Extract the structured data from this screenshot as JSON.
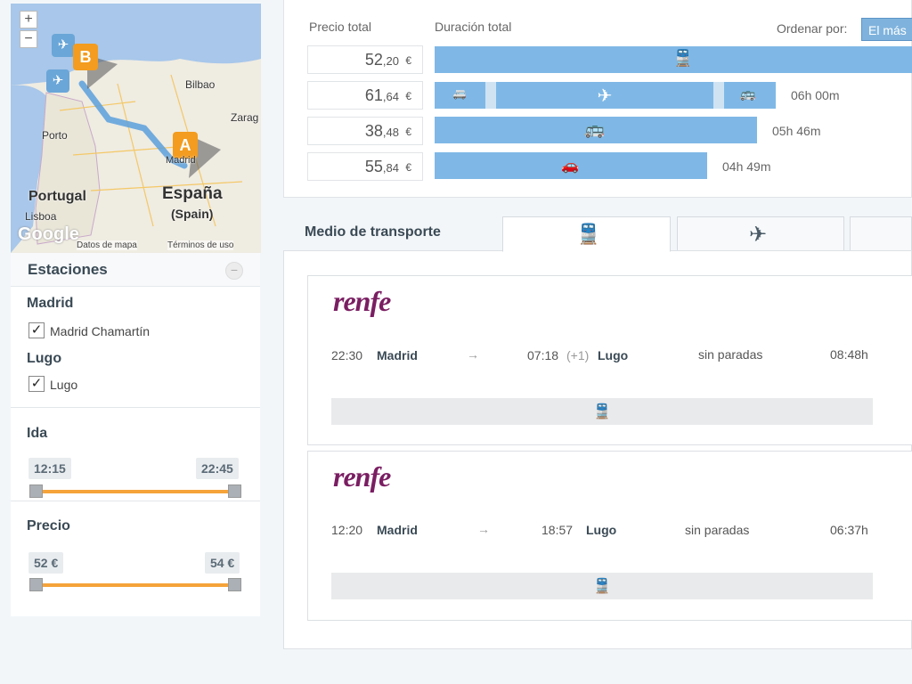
{
  "map": {
    "zoom_in": "+",
    "zoom_out": "−",
    "labels": [
      "Bilbao",
      "Zarag",
      "Porto",
      "Portugal",
      "Lisboa",
      "Madrid",
      "España",
      "(Spain)"
    ],
    "marker_a": "A",
    "marker_b": "B",
    "google": "Google",
    "attribution_data": "Datos de mapa",
    "attribution_terms": "Términos de uso"
  },
  "sidebar": {
    "stations_title": "Estaciones",
    "collapse": "−",
    "origin_city": "Madrid",
    "origin_station": "Madrid Chamartín",
    "dest_city": "Lugo",
    "dest_station": "Lugo",
    "check": "✓",
    "ida_title": "Ida",
    "ida_from": "12:15",
    "ida_to": "22:45",
    "precio_title": "Precio",
    "precio_from": "52 €",
    "precio_to": "54 €"
  },
  "summary": {
    "col_price": "Precio total",
    "col_duration": "Duración total",
    "sort_label": "Ordenar por:",
    "sort_value": "El más",
    "rows": [
      {
        "int": "52",
        "dec": ",20",
        "cur": "€",
        "duration": ""
      },
      {
        "int": "61",
        "dec": ",64",
        "cur": "€",
        "duration": "06h 00m"
      },
      {
        "int": "38",
        "dec": ",48",
        "cur": "€",
        "duration": "05h 46m"
      },
      {
        "int": "55",
        "dec": ",84",
        "cur": "€",
        "duration": "04h 49m"
      }
    ]
  },
  "results": {
    "tab_title": "Medio de transporte",
    "cards": [
      {
        "logo": "renfe",
        "dep_time": "22:30",
        "dep_city": "Madrid",
        "arrow": "→",
        "arr_time": "07:18",
        "arr_plus": "(+1)",
        "arr_city": "Lugo",
        "stops": "sin paradas",
        "duration": "08:48h"
      },
      {
        "logo": "renfe",
        "dep_time": "12:20",
        "dep_city": "Madrid",
        "arrow": "→",
        "arr_time": "18:57",
        "arr_plus": "",
        "arr_city": "Lugo",
        "stops": "sin paradas",
        "duration": "06:37h"
      }
    ]
  },
  "colors": {
    "bar": "#7fb8e6",
    "slider": "#f5a33a",
    "renfe": "#7a1e62",
    "marker": "#f39c1f",
    "route": "#5aa0dc"
  },
  "icons": [
    "train-icon",
    "plane-icon",
    "bus-icon",
    "car-icon",
    "van-icon"
  ]
}
